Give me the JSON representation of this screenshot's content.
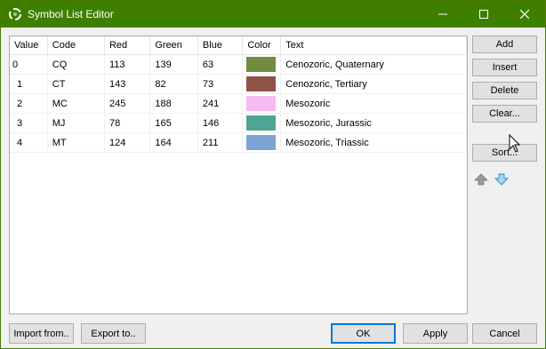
{
  "window": {
    "title": "Symbol List Editor",
    "accent_color": "#3f7f00"
  },
  "table": {
    "columns": [
      "Value",
      "Code",
      "Red",
      "Green",
      "Blue",
      "Color",
      "Text"
    ],
    "rows": [
      {
        "value": "0",
        "code": "CQ",
        "red": "113",
        "green": "139",
        "blue": "63",
        "color": "#718b3f",
        "text": "Cenozoric, Quaternary"
      },
      {
        "value": "1",
        "code": "CT",
        "red": "143",
        "green": "82",
        "blue": "73",
        "color": "#8f5249",
        "text": "Cenozoric, Tertiary"
      },
      {
        "value": "2",
        "code": "MC",
        "red": "245",
        "green": "188",
        "blue": "241",
        "color": "#f5bcf1",
        "text": "Mesozoric"
      },
      {
        "value": "3",
        "code": "MJ",
        "red": "78",
        "green": "165",
        "blue": "146",
        "color": "#4ea592",
        "text": "Mesozoric, Jurassic"
      },
      {
        "value": "4",
        "code": "MT",
        "red": "124",
        "green": "164",
        "blue": "211",
        "color": "#7ca4d3",
        "text": "Mesozoric, Triassic"
      }
    ]
  },
  "side_buttons": {
    "add": "Add",
    "insert": "Insert",
    "delete": "Delete",
    "clear": "Clear...",
    "sort": "Sort..."
  },
  "bottom_buttons": {
    "import": "Import from..",
    "export": "Export to..",
    "ok": "OK",
    "apply": "Apply",
    "cancel": "Cancel"
  },
  "icons": {
    "move_up": "arrow-up-icon",
    "move_down": "arrow-down-icon"
  }
}
